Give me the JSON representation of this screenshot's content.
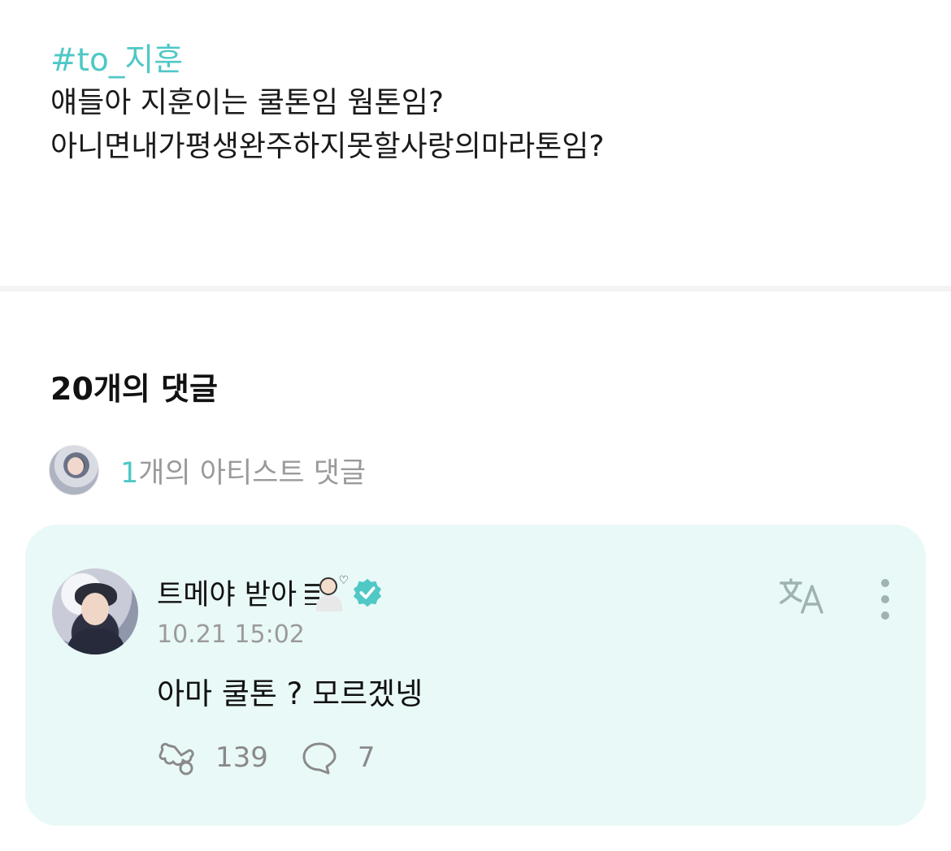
{
  "post": {
    "hashtag": "#to_지훈",
    "lines": [
      "얘들아 지훈이는 쿨톤임 웜톤임?",
      "아니면내가평생완주하지못할사랑의마라톤임?"
    ]
  },
  "comments": {
    "title": "20개의 댓글",
    "artist_count": "1",
    "artist_label": "개의 아티스트 댓글"
  },
  "comment": {
    "author": "트메야 받아",
    "timestamp": "10.21 15:02",
    "text": "아마 쿨톤 ? 모르겠넹",
    "likes": "139",
    "replies": "7"
  },
  "icons": {
    "translate": "translate-icon",
    "more": "more-vertical-icon",
    "like": "cheer-icon",
    "reply": "speech-bubble-icon",
    "verified": "verified-badge-icon"
  },
  "colors": {
    "accent": "#4fc8c6",
    "card_bg": "#e9f9f7",
    "muted": "#9b9b9b"
  }
}
